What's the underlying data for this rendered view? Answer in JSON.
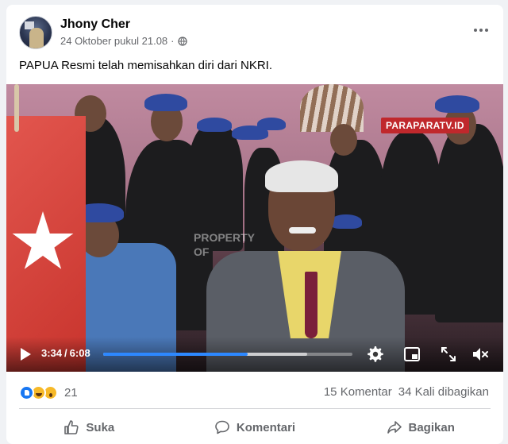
{
  "post": {
    "author": "Jhony Cher",
    "timestamp": "24 Oktober pukul 21.08",
    "separator": "·",
    "audience_icon": "globe-icon",
    "text": "PAPUA Resmi telah memisahkan diri dari NKRI."
  },
  "video": {
    "channel_badge": "PARAPARATV.ID",
    "watermark_line1": "PROPERTY",
    "watermark_line2": "OF",
    "current_time": "3:34",
    "time_separator": "/",
    "duration": "6:08",
    "progress_fraction": 0.58,
    "buffer_fraction": 0.82
  },
  "engagement": {
    "reaction_icons": [
      "like-reaction",
      "haha-reaction",
      "wow-reaction"
    ],
    "reaction_count": "21",
    "comments": "15 Komentar",
    "shares": "34 Kali dibagikan"
  },
  "actions": {
    "like": "Suka",
    "comment": "Komentari",
    "share": "Bagikan"
  },
  "colors": {
    "accent": "#2d88ff",
    "badge": "#c0282c",
    "like_blue": "#1877f2"
  }
}
